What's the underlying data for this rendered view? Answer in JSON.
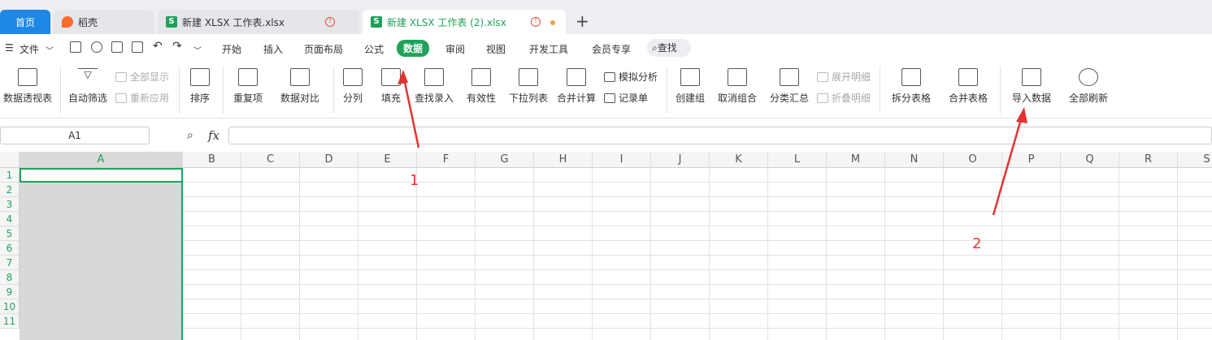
{
  "tabs": {
    "home": "首页",
    "daoke": "稻壳",
    "file1": "新建 XLSX 工作表.xlsx",
    "file2": "新建 XLSX 工作表 (2).xlsx",
    "new_tab": "+"
  },
  "menu": {
    "file": "文件",
    "items": [
      "开始",
      "插入",
      "页面布局",
      "公式",
      "数据",
      "审阅",
      "视图",
      "开发工具",
      "会员专享"
    ],
    "active": "数据",
    "search": "查找"
  },
  "ribbon": {
    "pivot": "数据透视表",
    "autofilter": "自动筛选",
    "show_all": "全部显示",
    "reapply": "重新应用",
    "sort": "排序",
    "duplicates": "重复项",
    "compare": "数据对比",
    "split": "分列",
    "fill": "填充",
    "lookup": "查找录入",
    "validity": "有效性",
    "dropdown": "下拉列表",
    "consolidate": "合并计算",
    "whatif": "模拟分析",
    "record": "记录单",
    "group": "创建组",
    "ungroup": "取消组合",
    "subtotal": "分类汇总",
    "expand": "展开明细",
    "collapse": "折叠明细",
    "split_table": "拆分表格",
    "merge_table": "合并表格",
    "import": "导入数据",
    "refresh_all": "全部刷新"
  },
  "formula": {
    "cell_ref": "A1",
    "fx": "fx"
  },
  "columns": [
    "A",
    "B",
    "C",
    "D",
    "E",
    "F",
    "G",
    "H",
    "I",
    "J",
    "K",
    "L",
    "M",
    "N",
    "O",
    "P",
    "Q",
    "R",
    "S"
  ],
  "rows": [
    "1",
    "2",
    "3",
    "4",
    "5",
    "6",
    "7",
    "8",
    "9",
    "10",
    "11"
  ],
  "annotations": {
    "label1": "1",
    "label2": "2"
  },
  "colors": {
    "accent": "#1ea35b",
    "home_tab": "#1e88e5",
    "annotation": "#e33333"
  }
}
